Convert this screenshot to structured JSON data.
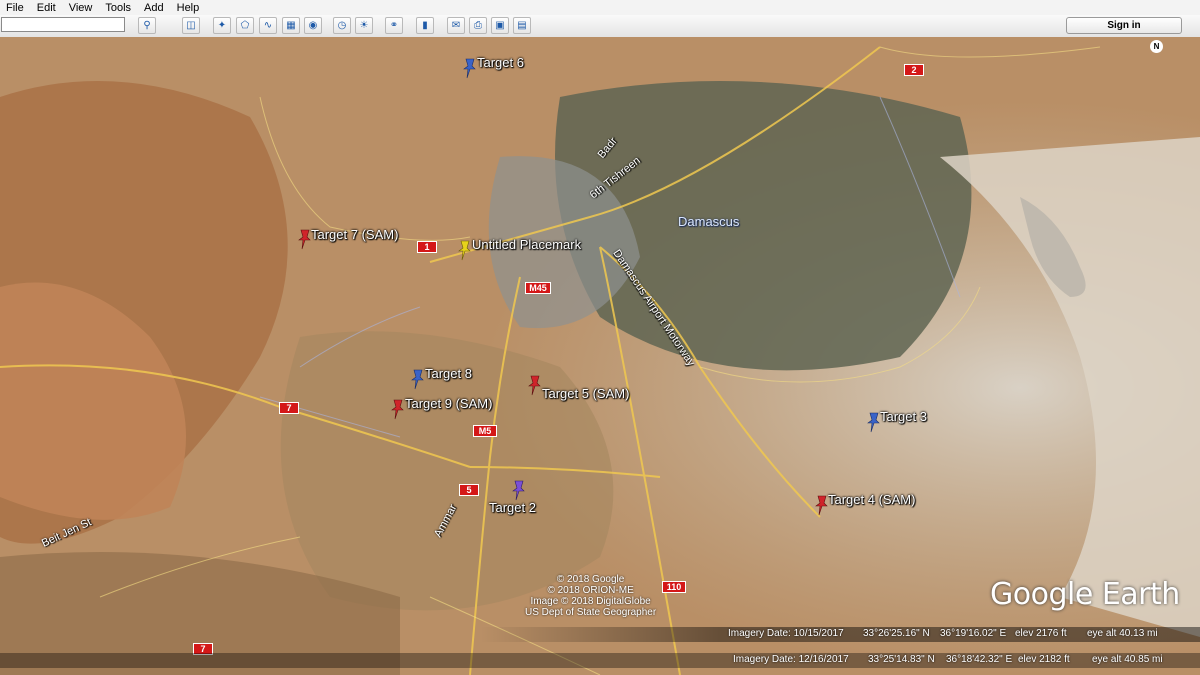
{
  "menu": [
    "File",
    "Edit",
    "View",
    "Tools",
    "Add",
    "Help"
  ],
  "search": {
    "placeholder": ""
  },
  "toolbar": {
    "sign_in_label": "Sign in"
  },
  "placemarks": [
    {
      "label": "Target 6",
      "color": "#3a63c8"
    },
    {
      "label": "Target 7 (SAM)",
      "color": "#d0242a"
    },
    {
      "label": "Untitled Placemark",
      "color": "#e6d21b"
    },
    {
      "label": "Target 8",
      "color": "#3a63c8"
    },
    {
      "label": "Target 9 (SAM)",
      "color": "#d0242a"
    },
    {
      "label": "Target 5 (SAM)",
      "color": "#d0242a"
    },
    {
      "label": "Target 3",
      "color": "#3a63c8"
    },
    {
      "label": "Target 4 (SAM)",
      "color": "#d0242a"
    },
    {
      "label": "Target 2",
      "color": "#7b4fd6"
    }
  ],
  "roads": {
    "shields": [
      "2",
      "1",
      "M45",
      "7",
      "M5",
      "5",
      "110",
      "7"
    ],
    "names": [
      "Badr",
      "6th Tishreen",
      "Damascus Airport Motorway",
      "Ammar",
      "Beit Jen St"
    ]
  },
  "city": "Damascus",
  "copyright": [
    "© 2018 Google",
    "© 2018 ORION-ME",
    "Image © 2018 DigitalGlobe",
    "US Dept of State Geographer"
  ],
  "logo": "Google Earth",
  "compass": "N",
  "status1": {
    "imagery": "Imagery Date: 10/15/2017",
    "lat": "33°26'25.16\" N",
    "lon": "36°19'16.02\" E",
    "elev": "elev  2176 ft",
    "eye": "eye alt  40.13 mi"
  },
  "status2": {
    "imagery": "Imagery Date: 12/16/2017",
    "lat": "33°25'14.83\" N",
    "lon": "36°18'42.32\" E",
    "elev": "elev  2182 ft",
    "eye": "eye alt  40.85 mi"
  }
}
